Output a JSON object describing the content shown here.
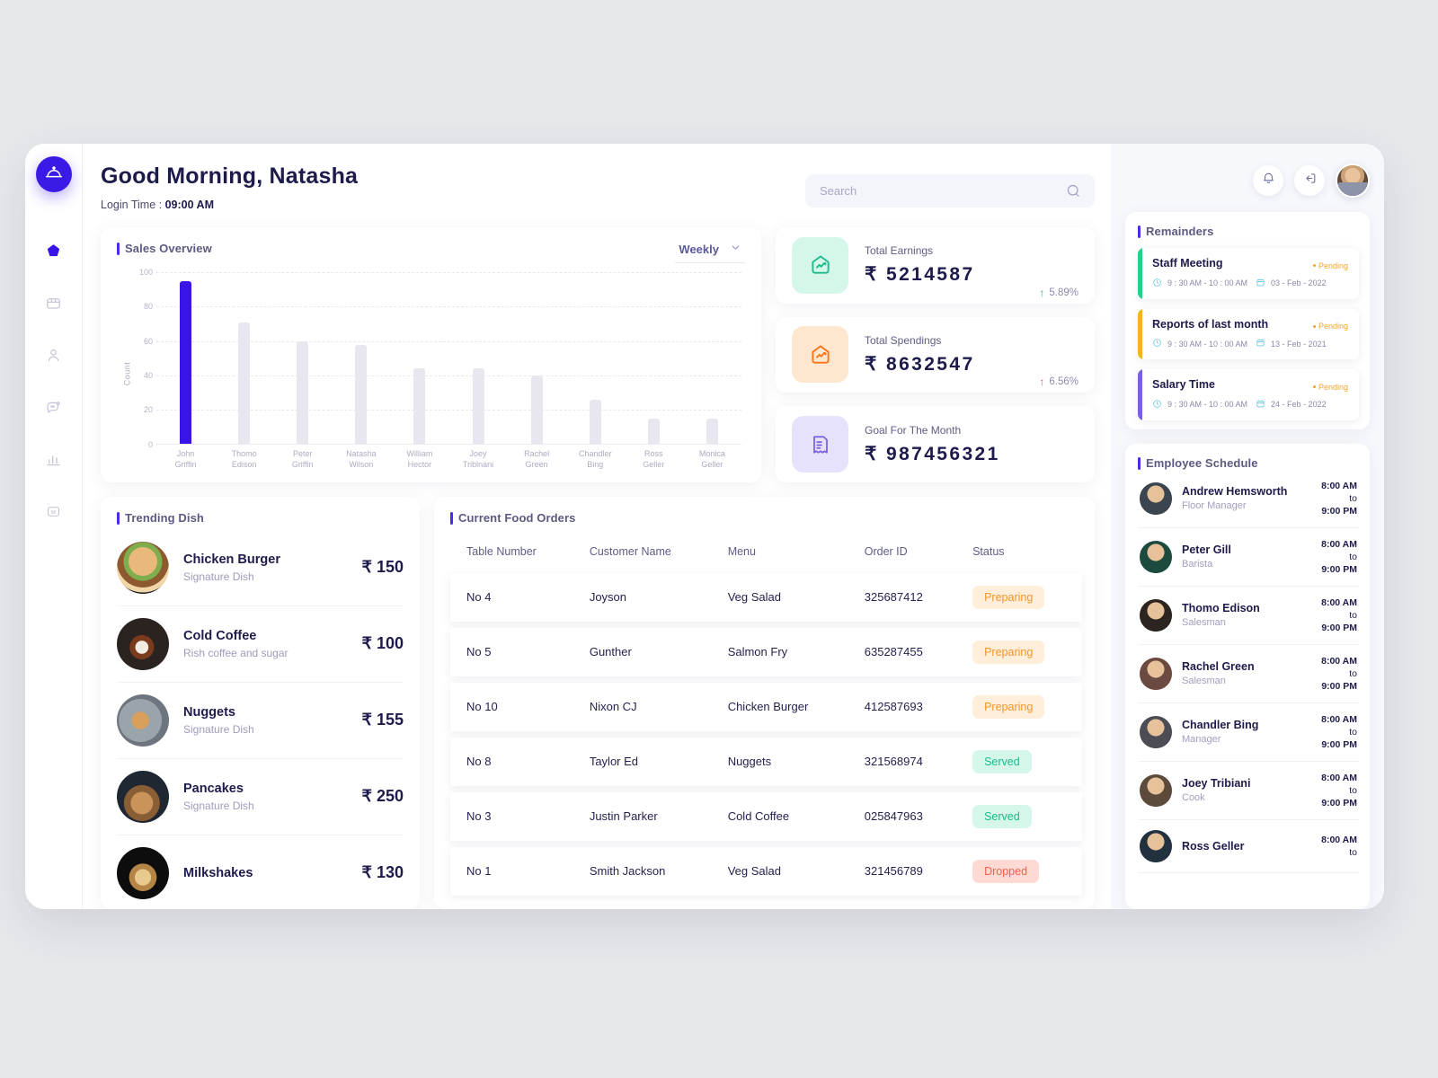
{
  "brand": {
    "accent": "#3a14e6",
    "logo_icon": "food-cloche-icon"
  },
  "sidebar": {
    "items": [
      {
        "name": "home",
        "icon": "home-icon",
        "active": true
      },
      {
        "name": "store",
        "icon": "store-icon",
        "active": false
      },
      {
        "name": "customers",
        "icon": "user-icon",
        "active": false
      },
      {
        "name": "messages",
        "icon": "chat-icon",
        "active": false
      },
      {
        "name": "analytics",
        "icon": "bar-chart-icon",
        "active": false
      },
      {
        "name": "settings",
        "icon": "settings-icon",
        "active": false
      }
    ]
  },
  "header": {
    "greeting": "Good  Morning, Natasha",
    "login_label": "Login Time : ",
    "login_time": "09:00 AM",
    "search_placeholder": "Search",
    "search_value": "",
    "notification_icon": "bell-icon",
    "logout_icon": "logout-icon",
    "avatar": "user-avatar"
  },
  "chart_data": {
    "type": "bar",
    "title": "Sales Overview",
    "xlabel": "",
    "ylabel": "Count",
    "ylim": [
      0,
      100
    ],
    "yticks": [
      0,
      20,
      40,
      60,
      80,
      100
    ],
    "grid": true,
    "legend": "none",
    "range_selector": "Weekly",
    "categories": [
      "John Griffin",
      "Thomo Edison",
      "Peter Griffin",
      "Natasha Wilson",
      "William Hector",
      "Joey Tribinani",
      "Rachel Green",
      "Chandler Bing",
      "Ross Geller",
      "Monica Geller"
    ],
    "values": [
      95,
      71,
      60,
      58,
      44,
      44,
      40,
      26,
      15,
      15
    ],
    "highlight_index": 0,
    "bar_color": "#e8e7ef",
    "highlight_color": "#3a14e6"
  },
  "stats": [
    {
      "label": "Total Earnings",
      "value": "₹ 5214587",
      "delta": "5.89%",
      "direction": "up",
      "delta_color": "#1cba8b",
      "icon": "trend-up-badge-icon",
      "icon_bg": "#d4f7ea",
      "icon_color": "#1cba8b"
    },
    {
      "label": "Total Spendings",
      "value": "₹ 8632547",
      "delta": "6.56%",
      "direction": "up",
      "delta_color": "#f4614a",
      "icon": "trend-up-badge-icon",
      "icon_bg": "#ffe7cf",
      "icon_color": "#f97316"
    },
    {
      "label": "Goal For The Month",
      "value": "₹ 987456321",
      "delta": "",
      "direction": "",
      "delta_color": "",
      "icon": "receipt-icon",
      "icon_bg": "#e7e2fb",
      "icon_color": "#7a60e0"
    }
  ],
  "trending": {
    "title": "Trending Dish",
    "items": [
      {
        "name": "Chicken Burger",
        "sub": "Signature Dish",
        "price": "₹ 150",
        "img": "burger-photo"
      },
      {
        "name": "Cold Coffee",
        "sub": "Rish coffee and sugar",
        "price": "₹ 100",
        "img": "cold-coffee-photo"
      },
      {
        "name": "Nuggets",
        "sub": "Signature Dish",
        "price": "₹ 155",
        "img": "nuggets-photo"
      },
      {
        "name": "Pancakes",
        "sub": "Signature Dish",
        "price": "₹ 250",
        "img": "pancakes-photo"
      },
      {
        "name": "Milkshakes",
        "sub": "",
        "price": "₹ 130",
        "img": "milkshake-photo"
      }
    ]
  },
  "orders": {
    "title": "Current Food Orders",
    "columns": [
      "Table Number",
      "Customer Name",
      "Menu",
      "Order ID",
      "Status"
    ],
    "rows": [
      {
        "table": "No 4",
        "customer": "Joyson",
        "menu": "Veg Salad",
        "order_id": "325687412",
        "status": "Preparing",
        "status_kind": "preparing"
      },
      {
        "table": "No 5",
        "customer": "Gunther",
        "menu": "Salmon Fry",
        "order_id": "635287455",
        "status": "Preparing",
        "status_kind": "preparing"
      },
      {
        "table": "No 10",
        "customer": "Nixon CJ",
        "menu": "Chicken Burger",
        "order_id": "412587693",
        "status": "Preparing",
        "status_kind": "preparing"
      },
      {
        "table": "No 8",
        "customer": "Taylor Ed",
        "menu": "Nuggets",
        "order_id": "321568974",
        "status": "Served",
        "status_kind": "served"
      },
      {
        "table": "No 3",
        "customer": "Justin Parker",
        "menu": "Cold Coffee",
        "order_id": "025847963",
        "status": "Served",
        "status_kind": "served"
      },
      {
        "table": "No 1",
        "customer": "Smith Jackson",
        "menu": "Veg Salad",
        "order_id": "321456789",
        "status": "Dropped",
        "status_kind": "dropped"
      }
    ]
  },
  "reminders": {
    "title": "Remainders",
    "items": [
      {
        "title": "Staff Meeting",
        "time": "9 : 30 AM - 10 : 00 AM",
        "date": "03 - Feb - 2022",
        "status": "Pending",
        "bar_color": "#24d18a"
      },
      {
        "title": "Reports of last month",
        "time": "9 : 30 AM - 10 : 00 AM",
        "date": "13 - Feb - 2021",
        "status": "Pending",
        "bar_color": "#f6b323"
      },
      {
        "title": "Salary Time",
        "time": "9 : 30 AM - 10 : 00 AM",
        "date": "24 - Feb - 2022",
        "status": "Pending",
        "bar_color": "#7a60e0"
      }
    ]
  },
  "employee_schedule": {
    "title": "Employee Schedule",
    "items": [
      {
        "name": "Andrew Hemsworth",
        "role": "Floor Manager",
        "start": "8:00 AM",
        "to": "to",
        "end": "9:00 PM",
        "av1": "#8796a8",
        "av2": "#3b4550"
      },
      {
        "name": "Peter Gill",
        "role": "Barista",
        "start": "8:00 AM",
        "to": "to",
        "end": "9:00 PM",
        "av1": "#b7e0e8",
        "av2": "#1d4a3e"
      },
      {
        "name": "Thomo Edison",
        "role": "Salesman",
        "start": "8:00 AM",
        "to": "to",
        "end": "9:00 PM",
        "av1": "#c79a6e",
        "av2": "#2b2420"
      },
      {
        "name": "Rachel Green",
        "role": "Salesman",
        "start": "8:00 AM",
        "to": "to",
        "end": "9:00 PM",
        "av1": "#e9b3b6",
        "av2": "#6b4a42"
      },
      {
        "name": "Chandler Bing",
        "role": "Manager",
        "start": "8:00 AM",
        "to": "to",
        "end": "9:00 PM",
        "av1": "#bcbcc4",
        "av2": "#4c4c54"
      },
      {
        "name": "Joey Tribiani",
        "role": "Cook",
        "start": "8:00 AM",
        "to": "to",
        "end": "9:00 PM",
        "av1": "#d9c6b0",
        "av2": "#5c4a3a"
      },
      {
        "name": "Ross Geller",
        "role": "",
        "start": "8:00 AM",
        "to": "to",
        "end": "",
        "av1": "#7fd0ee",
        "av2": "#23313f"
      }
    ]
  }
}
